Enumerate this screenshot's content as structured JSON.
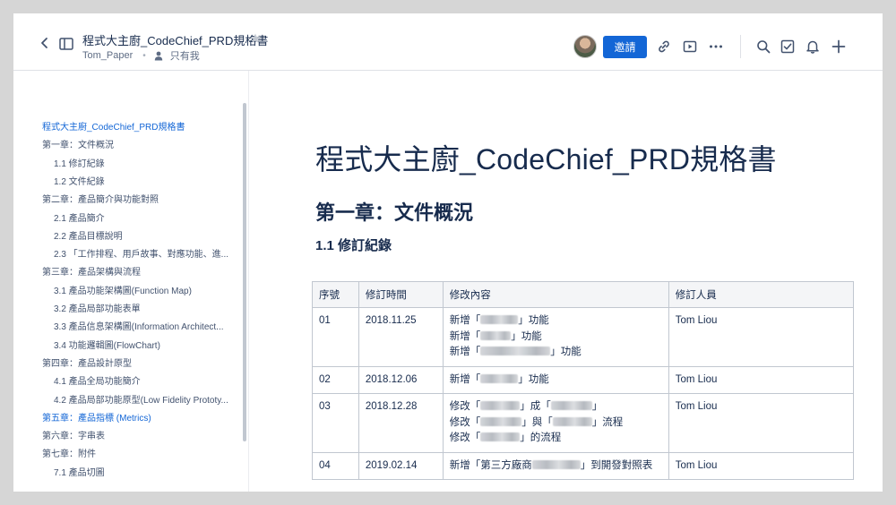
{
  "header": {
    "title": "程式大主廚_CodeChief_PRD規格書",
    "author": "Tom_Paper",
    "separator": "•",
    "permission": "只有我",
    "invite_label": "邀請"
  },
  "sidebar": {
    "toc": [
      {
        "label": "程式大主廚_CodeChief_PRD規格書",
        "level": 1,
        "active": true
      },
      {
        "label": "第一章：文件概況",
        "level": 1,
        "active": false
      },
      {
        "label": "1.1 修訂紀錄",
        "level": 2,
        "active": false
      },
      {
        "label": "1.2 文件紀錄",
        "level": 2,
        "active": false
      },
      {
        "label": "第二章：產品簡介與功能對照",
        "level": 1,
        "active": false
      },
      {
        "label": "2.1 產品簡介",
        "level": 2,
        "active": false
      },
      {
        "label": "2.2 產品目標說明",
        "level": 2,
        "active": false
      },
      {
        "label": "2.3 「工作排程、用戶故事、對應功能、進...",
        "level": 2,
        "active": false
      },
      {
        "label": "第三章：產品架構與流程",
        "level": 1,
        "active": false
      },
      {
        "label": "3.1 產品功能架構圖(Function Map)",
        "level": 2,
        "active": false
      },
      {
        "label": "3.2 產品局部功能表單",
        "level": 2,
        "active": false
      },
      {
        "label": "3.3 產品信息架構圖(Information Architect...",
        "level": 2,
        "active": false
      },
      {
        "label": "3.4 功能邏輯圖(FlowChart)",
        "level": 2,
        "active": false
      },
      {
        "label": "第四章：產品設計原型",
        "level": 1,
        "active": false
      },
      {
        "label": "4.1 產品全局功能簡介",
        "level": 2,
        "active": false
      },
      {
        "label": "4.2 產品局部功能原型(Low Fidelity Prototy...",
        "level": 2,
        "active": false
      },
      {
        "label": "第五章：產品指標 (Metrics)",
        "level": 1,
        "active": true
      },
      {
        "label": "第六章：字串表",
        "level": 1,
        "active": false
      },
      {
        "label": "第七章：附件",
        "level": 1,
        "active": false
      },
      {
        "label": "7.1 產品切圖",
        "level": 2,
        "active": false
      }
    ]
  },
  "main": {
    "page_title": "程式大主廚_CodeChief_PRD規格書",
    "chapter_heading": "第一章：文件概況",
    "section_heading": "1.1 修訂紀錄",
    "table": {
      "columns": [
        "序號",
        "修訂時間",
        "修改內容",
        "修訂人員"
      ],
      "rows": [
        {
          "no": "01",
          "date": "2018.11.25",
          "author": "Tom Liou",
          "changes": [
            [
              "新增「",
              {
                "blur": 42
              },
              "」功能"
            ],
            [
              "新增「",
              {
                "blur": 34
              },
              "」功能"
            ],
            [
              "新增「",
              {
                "blur": 78
              },
              "」功能"
            ]
          ]
        },
        {
          "no": "02",
          "date": "2018.12.06",
          "author": "Tom Liou",
          "changes": [
            [
              "新增「",
              {
                "blur": 42
              },
              "」功能"
            ]
          ]
        },
        {
          "no": "03",
          "date": "2018.12.28",
          "author": "Tom Liou",
          "changes": [
            [
              "修改「",
              {
                "blur": 44
              },
              "」成「",
              {
                "blur": 46
              },
              "」"
            ],
            [
              "修改「",
              {
                "blur": 46
              },
              "」與「",
              {
                "blur": 44
              },
              "」流程"
            ],
            [
              "修改「",
              {
                "blur": 44
              },
              "」的流程"
            ]
          ]
        },
        {
          "no": "04",
          "date": "2019.02.14",
          "author": "Tom Liou",
          "changes": [
            [
              "新增「第三方廠商",
              {
                "blur": 54
              },
              "」到開發對照表"
            ]
          ]
        }
      ]
    }
  },
  "icons": {
    "back": "chevron-left-icon",
    "sidebar_toggle": "sidebar-panel-icon",
    "star": "star-icon",
    "person": "person-icon",
    "link": "link-icon",
    "present": "present-icon",
    "more": "more-icon",
    "search": "search-icon",
    "task": "checkbox-icon",
    "bell": "bell-icon",
    "add": "plus-icon"
  },
  "colors": {
    "accent": "#1366d6",
    "text": "#172b4d",
    "muted": "#5e6c84",
    "border": "#c1c7d0"
  }
}
